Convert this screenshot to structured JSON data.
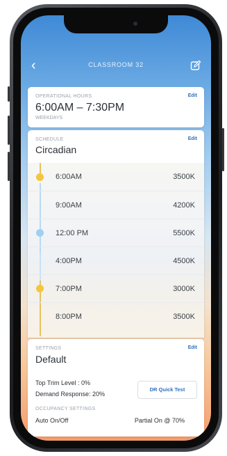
{
  "header": {
    "title": "CLASSROOM 32"
  },
  "operational_hours": {
    "label": "OPERATIONAL HOURS",
    "edit_label": "Edit",
    "time_range": "6:00AM – 7:30PM",
    "days": "WEEKDAYS"
  },
  "schedule": {
    "label": "SCHEDULE",
    "edit_label": "Edit",
    "name": "Circadian",
    "rows": [
      {
        "time": "6:00AM",
        "kelvin": "3500K"
      },
      {
        "time": "9:00AM",
        "kelvin": "4200K"
      },
      {
        "time": "12:00 PM",
        "kelvin": "5500K"
      },
      {
        "time": "4:00PM",
        "kelvin": "4500K"
      },
      {
        "time": "7:00PM",
        "kelvin": "3000K"
      },
      {
        "time": "8:00PM",
        "kelvin": "3500K"
      }
    ]
  },
  "settings": {
    "label": "SETTINGS",
    "edit_label": "Edit",
    "name": "Default",
    "top_trim": "Top Trim Level  : 0%",
    "demand_response": "Demand Response: 20%",
    "quick_test_label": "DR Quick Test",
    "occupancy_label": "OCCUPANCY SETTINGS",
    "occupancy_mode": "Auto On/Off",
    "partial_on": "Partial On @ 70%"
  },
  "colors": {
    "accent": "#2f6fb8",
    "warm_dot": "#f3c640",
    "cool_dot": "#9fd0f2"
  }
}
